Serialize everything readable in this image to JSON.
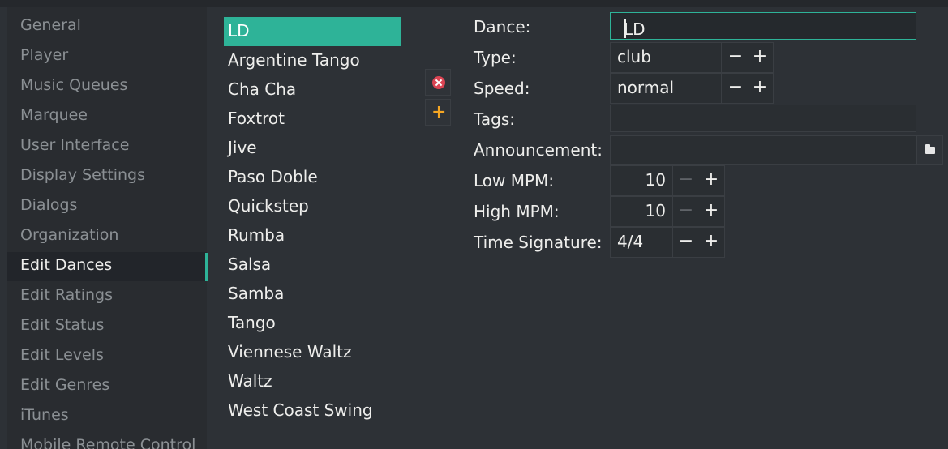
{
  "sidebar": {
    "items": [
      {
        "label": "General"
      },
      {
        "label": "Player"
      },
      {
        "label": "Music Queues"
      },
      {
        "label": "Marquee"
      },
      {
        "label": "User Interface"
      },
      {
        "label": "Display Settings"
      },
      {
        "label": "Dialogs"
      },
      {
        "label": "Organization"
      },
      {
        "label": "Edit Dances"
      },
      {
        "label": "Edit Ratings"
      },
      {
        "label": "Edit Status"
      },
      {
        "label": "Edit Levels"
      },
      {
        "label": "Edit Genres"
      },
      {
        "label": "iTunes"
      },
      {
        "label": "Mobile Remote Control"
      }
    ]
  },
  "dances": {
    "items": [
      {
        "label": "LD"
      },
      {
        "label": "Argentine Tango"
      },
      {
        "label": "Cha Cha"
      },
      {
        "label": "Foxtrot"
      },
      {
        "label": "Jive"
      },
      {
        "label": "Paso Doble"
      },
      {
        "label": "Quickstep"
      },
      {
        "label": "Rumba"
      },
      {
        "label": "Salsa"
      },
      {
        "label": "Samba"
      },
      {
        "label": "Tango"
      },
      {
        "label": "Viennese Waltz"
      },
      {
        "label": "Waltz"
      },
      {
        "label": "West Coast Swing"
      }
    ]
  },
  "form": {
    "dance_label": "Dance:",
    "dance_value": "LD",
    "type_label": "Type:",
    "type_value": "club",
    "speed_label": "Speed:",
    "speed_value": "normal",
    "tags_label": "Tags:",
    "tags_value": "",
    "announcement_label": "Announcement:",
    "announcement_value": "",
    "low_mpm_label": "Low MPM:",
    "low_mpm_value": "10",
    "high_mpm_label": "High MPM:",
    "high_mpm_value": "10",
    "time_sig_label": "Time Signature:",
    "time_sig_value": "4/4"
  },
  "spin": {
    "minus": "−",
    "plus": "+"
  },
  "colors": {
    "accent": "#2eb398",
    "remove": "#da4453",
    "add": "#f5a623"
  }
}
